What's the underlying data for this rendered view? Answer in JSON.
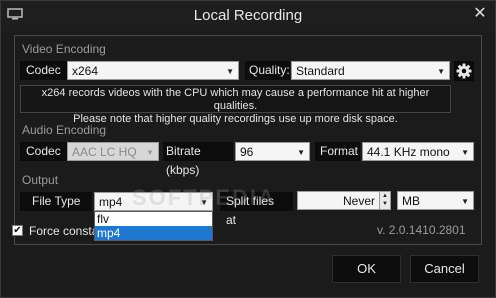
{
  "window": {
    "title": "Local Recording",
    "close_glyph": "✕"
  },
  "video": {
    "section_label": "Video Encoding",
    "codec_label": "Codec",
    "codec_value": "x264",
    "quality_label": "Quality:",
    "quality_value": "Standard",
    "note_line1": "x264 records videos with the CPU which may cause a performance hit at higher qualities.",
    "note_line2": "Please note that higher quality recordings use up more disk space."
  },
  "audio": {
    "section_label": "Audio Encoding",
    "codec_label": "Codec",
    "codec_value": "AAC LC HQ",
    "bitrate_label": "Bitrate (kbps)",
    "bitrate_value": "96",
    "format_label": "Format",
    "format_value": "44.1 KHz mono"
  },
  "output": {
    "section_label": "Output",
    "file_type_label": "File Type",
    "file_type_value": "mp4",
    "file_type_options": [
      "flv",
      "mp4"
    ],
    "split_label": "Split files at",
    "split_value": "Never",
    "split_unit": "MB"
  },
  "force_label": "Force constar",
  "force_checked": true,
  "version": "v. 2.0.1410.2801",
  "buttons": {
    "ok": "OK",
    "cancel": "Cancel"
  },
  "watermark": "SOFTPEDIA"
}
